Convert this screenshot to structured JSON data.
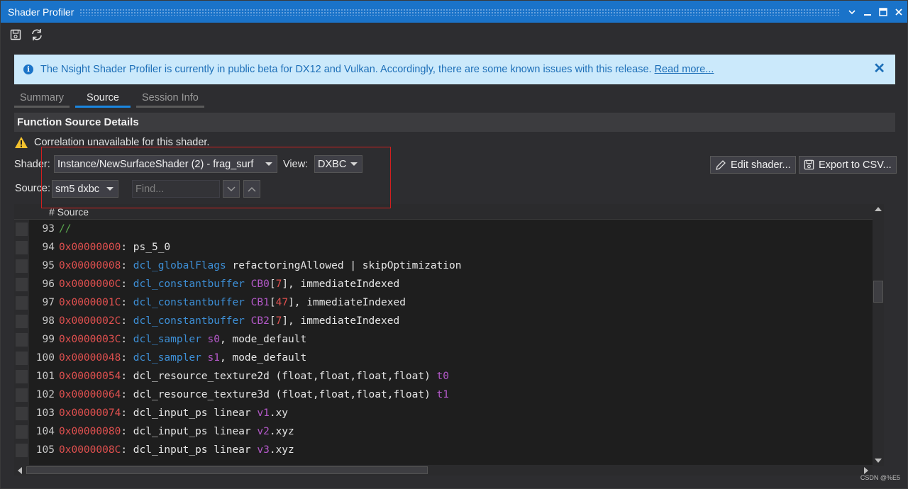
{
  "window": {
    "title": "Shader Profiler"
  },
  "toolbar": {
    "save_icon": "save-icon",
    "refresh_icon": "refresh-icon"
  },
  "info_bar": {
    "message": "The Nsight Shader Profiler is currently in public beta for DX12 and Vulkan. Accordingly, there are some known issues with this release.",
    "link": "Read more...",
    "close": "✕"
  },
  "tabs": [
    {
      "label": "Summary",
      "active": false
    },
    {
      "label": "Source",
      "active": true
    },
    {
      "label": "Session Info",
      "active": false
    }
  ],
  "section": {
    "title": "Function Source Details"
  },
  "warning": {
    "text": "Correlation unavailable for this shader."
  },
  "controls": {
    "shader_label": "Shader:",
    "shader_value": "Instance/NewSurfaceShader (2) - frag_surf",
    "view_label": "View:",
    "view_value": "DXBC",
    "source_label": "Source:",
    "source_value": "sm5 dxbc",
    "find_placeholder": "Find...",
    "edit_shader": "Edit shader...",
    "export_csv": "Export to CSV..."
  },
  "code": {
    "header": "# Source",
    "lines": [
      {
        "n": "93",
        "addr": "",
        "rest": [
          [
            "cmt",
            "//"
          ]
        ]
      },
      {
        "n": "94",
        "addr": "0x00000000",
        "rest": [
          [
            "p",
            ": ps_5_0"
          ]
        ]
      },
      {
        "n": "95",
        "addr": "0x00000008",
        "rest": [
          [
            "p",
            ": "
          ],
          [
            "kw",
            "dcl_globalFlags"
          ],
          [
            "p",
            " refactoringAllowed | skipOptimization"
          ]
        ]
      },
      {
        "n": "96",
        "addr": "0x0000000C",
        "rest": [
          [
            "p",
            ": "
          ],
          [
            "kw",
            "dcl_constantbuffer"
          ],
          [
            "p",
            " "
          ],
          [
            "reg",
            "CB0"
          ],
          [
            "p",
            "["
          ],
          [
            "num",
            "7"
          ],
          [
            "p",
            "], immediateIndexed"
          ]
        ]
      },
      {
        "n": "97",
        "addr": "0x0000001C",
        "rest": [
          [
            "p",
            ": "
          ],
          [
            "kw",
            "dcl_constantbuffer"
          ],
          [
            "p",
            " "
          ],
          [
            "reg",
            "CB1"
          ],
          [
            "p",
            "["
          ],
          [
            "num",
            "47"
          ],
          [
            "p",
            "], immediateIndexed"
          ]
        ]
      },
      {
        "n": "98",
        "addr": "0x0000002C",
        "rest": [
          [
            "p",
            ": "
          ],
          [
            "kw",
            "dcl_constantbuffer"
          ],
          [
            "p",
            " "
          ],
          [
            "reg",
            "CB2"
          ],
          [
            "p",
            "["
          ],
          [
            "num",
            "7"
          ],
          [
            "p",
            "], immediateIndexed"
          ]
        ]
      },
      {
        "n": "99",
        "addr": "0x0000003C",
        "rest": [
          [
            "p",
            ": "
          ],
          [
            "kw",
            "dcl_sampler"
          ],
          [
            "p",
            " "
          ],
          [
            "reg",
            "s0"
          ],
          [
            "p",
            ", mode_default"
          ]
        ]
      },
      {
        "n": "100",
        "addr": "0x00000048",
        "rest": [
          [
            "p",
            ": "
          ],
          [
            "kw",
            "dcl_sampler"
          ],
          [
            "p",
            " "
          ],
          [
            "reg",
            "s1"
          ],
          [
            "p",
            ", mode_default"
          ]
        ]
      },
      {
        "n": "101",
        "addr": "0x00000054",
        "rest": [
          [
            "p",
            ": dcl_resource_texture2d (float,float,float,float) "
          ],
          [
            "reg",
            "t0"
          ]
        ]
      },
      {
        "n": "102",
        "addr": "0x00000064",
        "rest": [
          [
            "p",
            ": dcl_resource_texture3d (float,float,float,float) "
          ],
          [
            "reg",
            "t1"
          ]
        ]
      },
      {
        "n": "103",
        "addr": "0x00000074",
        "rest": [
          [
            "p",
            ": dcl_input_ps linear "
          ],
          [
            "reg",
            "v1"
          ],
          [
            "p",
            ".xy"
          ]
        ]
      },
      {
        "n": "104",
        "addr": "0x00000080",
        "rest": [
          [
            "p",
            ": dcl_input_ps linear "
          ],
          [
            "reg",
            "v2"
          ],
          [
            "p",
            ".xyz"
          ]
        ]
      },
      {
        "n": "105",
        "addr": "0x0000008C",
        "rest": [
          [
            "p",
            ": dcl_input_ps linear "
          ],
          [
            "reg",
            "v3"
          ],
          [
            "p",
            ".xyz"
          ]
        ]
      }
    ]
  },
  "watermark": "CSDN @%E5",
  "colors": {
    "title_bar": "#1a73c9",
    "info_bg": "#cbe9fb",
    "address": "#e0504f",
    "keyword": "#3d8fd6",
    "register": "#b459c9",
    "comment": "#5aa84e",
    "highlight_box": "#d21f1f"
  }
}
